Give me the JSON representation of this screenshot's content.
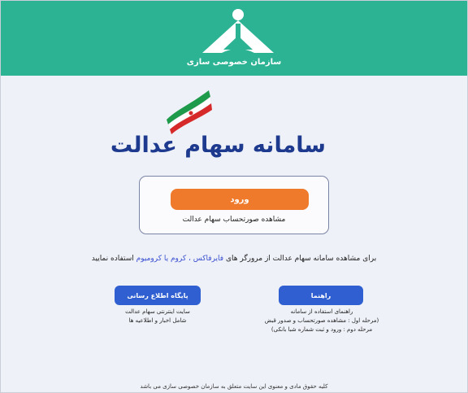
{
  "header": {
    "org_name": "سازمان خصوصی سازی",
    "background": "#2cb394"
  },
  "brand": {
    "site_title": "سامانه سهام عدالت"
  },
  "login": {
    "button_label": "ورود",
    "subtitle": "مشاهده صورتحساب سهام عدالت",
    "button_color": "#f07a2c"
  },
  "browser_note": {
    "prefix": "برای مشاهده سامانه سهام عدالت از مرورگر های ",
    "browsers": "فایرفاکس ، کروم یا کرومیوم",
    "suffix": " استفاده نمایید"
  },
  "guide": {
    "button_label": "راهنما",
    "lines": [
      "راهنمای استفاده از سامانه",
      "(مرحله اول : مشاهده صورتحساب و صدور قبض",
      "مرحله دوم : ورود و ثبت شماره شبا بانکی)"
    ]
  },
  "ebay": {
    "button_label": "پایگاه اطلاع رسانی",
    "lines": [
      "سایت اینترنتی سهام عدالت",
      "شامل اخبار و اطلاعیه ها"
    ]
  },
  "footer": {
    "text": "کلیه حقوق مادی و معنوی این سایت متعلق به سازمان خصوصی سازی می باشد"
  },
  "colors": {
    "accent_blue": "#2f5fd0",
    "title_blue": "#1d3a8f"
  },
  "icons": [
    "org-logo-icon",
    "iran-flag-icon"
  ]
}
